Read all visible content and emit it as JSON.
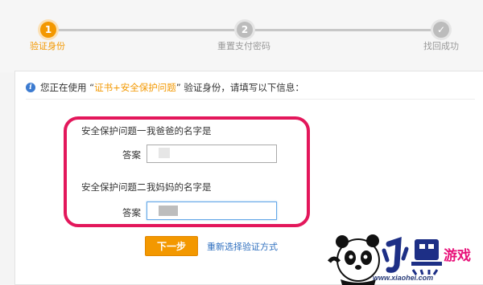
{
  "stepper": {
    "steps": [
      {
        "number": "1",
        "label": "验证身份",
        "state": "active"
      },
      {
        "number": "2",
        "label": "重置支付密码",
        "state": "inactive"
      },
      {
        "number": "✓",
        "label": "找回成功",
        "state": "inactive"
      }
    ]
  },
  "notice": {
    "prefix": "您正在使用 “",
    "method": "证书+安全保护问题",
    "suffix": "” 验证身份，请填写以下信息："
  },
  "form": {
    "q1_label": "安全保护问题一",
    "q1_text": "我爸爸的名字是",
    "answer_label_1": "答案",
    "q2_label": "安全保护问题二",
    "q2_text": "我妈妈的名字是",
    "answer_label_2": "答案"
  },
  "actions": {
    "next_label": "下一步",
    "reselect_label": "重新选择验证方式"
  },
  "watermark": {
    "url": "www.xiaohei.com"
  },
  "colors": {
    "accent": "#f39800",
    "highlight": "#e3175b",
    "link": "#2f6fbf"
  }
}
